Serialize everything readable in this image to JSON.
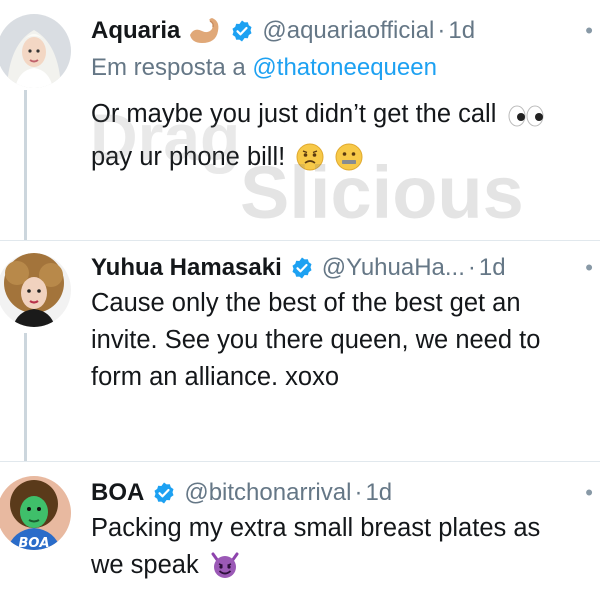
{
  "tweets": [
    {
      "name": "Aquaria",
      "name_glyph": "flexed-arm-emoji",
      "handle": "@aquariaofficial",
      "separator": "·",
      "time": "1d",
      "more": "•",
      "reply_prefix": "Em resposta a",
      "reply_mention": "@thatoneequeen",
      "lines": [
        "Or maybe you just didn’t get the call",
        "pay ur phone bill!"
      ]
    },
    {
      "name": "Yuhua Hamasaki",
      "handle": "@YuhuaHa...",
      "separator": "·",
      "time": "1d",
      "more": "•",
      "lines": [
        "Cause only the best of the best get an",
        "invite.  See you there queen, we need to",
        "form an alliance. xoxo"
      ]
    },
    {
      "name": "BOA",
      "handle": "@bitchonarrival",
      "separator": "·",
      "time": "1d",
      "more": "•",
      "lines": [
        "Packing my extra small breast plates as",
        "we speak"
      ]
    }
  ],
  "watermark": {
    "line1": "Drag",
    "line2": "Slicious"
  },
  "colors": {
    "link": "#1da1f2",
    "muted": "#657786",
    "text": "#14171a",
    "thread": "#ccd6dd",
    "verified": "#1da1f2"
  }
}
